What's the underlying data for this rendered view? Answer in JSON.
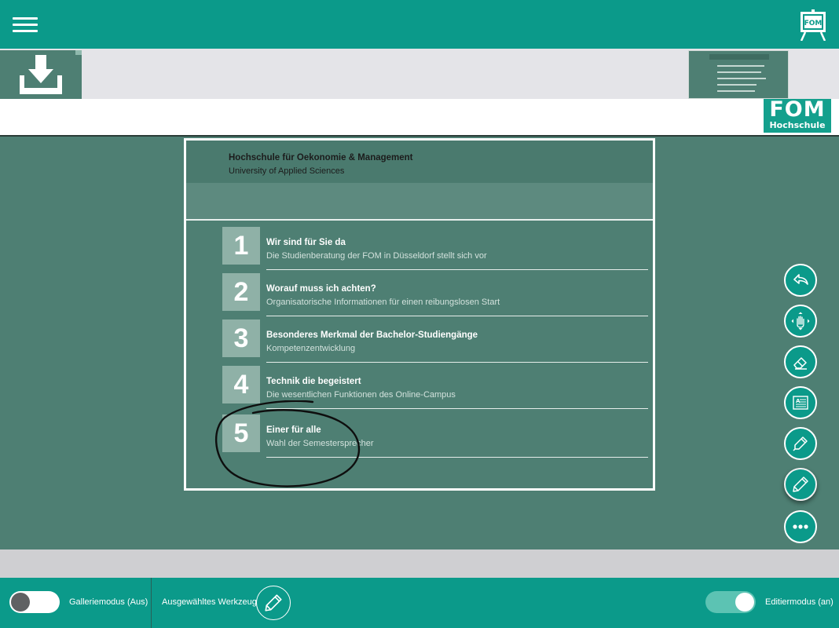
{
  "slide": {
    "school_name": "Hochschule für Oekonomie & Management",
    "school_subtitle": "University of Applied Sciences",
    "agenda": [
      {
        "number": "1",
        "title": "Wir sind für Sie da",
        "subtitle": "Die Studienberatung der FOM in Düsseldorf stellt sich vor"
      },
      {
        "number": "2",
        "title": "Worauf muss ich achten?",
        "subtitle": "Organisatorische Informationen für einen reibungslosen Start"
      },
      {
        "number": "3",
        "title": "Besonderes Merkmal der Bachelor-Studiengänge",
        "subtitle": "Kompetenzentwicklung"
      },
      {
        "number": "4",
        "title": "Technik die begeistert",
        "subtitle": "Die wesentlichen Funktionen des Online-Campus"
      },
      {
        "number": "5",
        "title": "Einer für alle",
        "subtitle": "Wahl der Semestersprecher"
      }
    ]
  },
  "logo": {
    "brand": "FOM",
    "subtitle": "Hochschule"
  },
  "tools": [
    {
      "name": "undo-icon",
      "selected": false
    },
    {
      "name": "move-hand-icon",
      "selected": false
    },
    {
      "name": "eraser-icon",
      "selected": false
    },
    {
      "name": "text-box-icon",
      "selected": false
    },
    {
      "name": "highlighter-icon",
      "selected": false
    },
    {
      "name": "pen-icon",
      "selected": true
    },
    {
      "name": "more-icon",
      "selected": false
    }
  ],
  "bottombar": {
    "gallery_label": "Galleriemodus (Aus)",
    "gallery_on": false,
    "selected_tool_label": "Ausgewähltes Werkzeug",
    "edit_label": "Editiermodus (an)",
    "edit_on": true
  },
  "colors": {
    "primary": "#0b9a8a",
    "canvas": "#4e7f73",
    "logo": "#14a08d"
  }
}
